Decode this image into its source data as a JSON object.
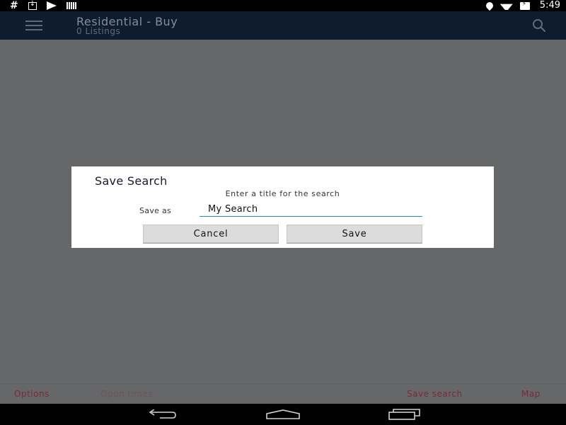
{
  "status_bar": {
    "left_glyph": "#",
    "time": "5:49",
    "icons_left": [
      "download-icon",
      "play-store-icon",
      "barcode-icon"
    ],
    "icons_right": [
      "location-icon",
      "wifi-icon",
      "battery-charging-icon"
    ]
  },
  "header": {
    "title": "Residential - Buy",
    "subtitle": "0 Listings"
  },
  "dialog": {
    "title": "Save Search",
    "message": "Enter a title for the search",
    "field_label": "Save as",
    "field_value": "My Search",
    "cancel_label": "Cancel",
    "save_label": "Save"
  },
  "bottom_bar": {
    "options": "Options",
    "open_times": "Open times",
    "save_search": "Save search",
    "map": "Map"
  },
  "colors": {
    "appbar": "#0e1c2e",
    "overlay": "#666769",
    "accent_link": "#7a2a3a",
    "input_underline": "#2b8fb3"
  }
}
